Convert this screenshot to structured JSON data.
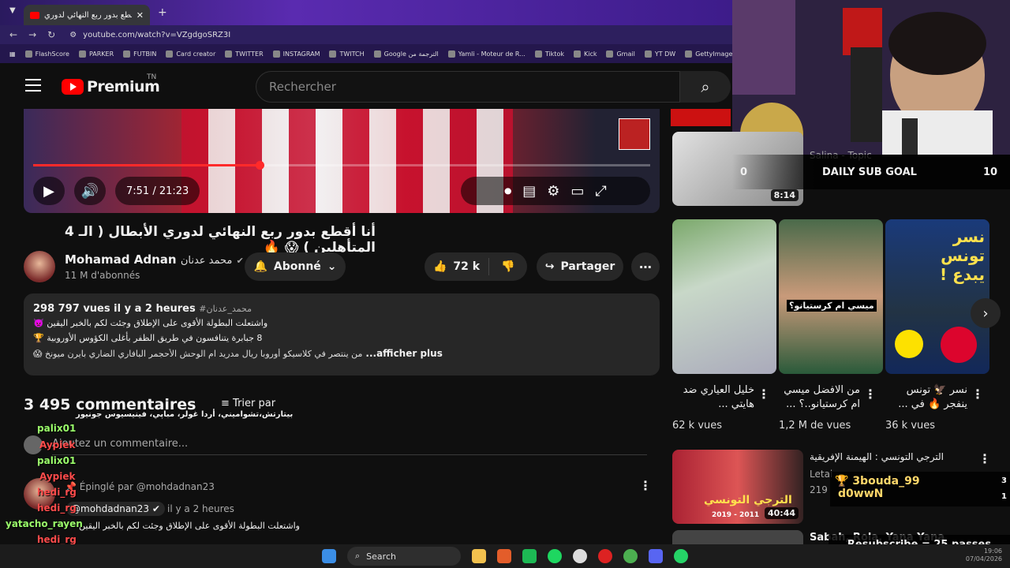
{
  "browser": {
    "tab_title": "أنا أقطع بدور ربع النهائي لدوري ...",
    "url": "youtube.com/watch?v=VZgdgoSRZ3I",
    "bookmarks": [
      "FlashScore",
      "PARKER",
      "FUTBIN",
      "Card creator",
      "TWITTER",
      "INSTAGRAM",
      "TWITCH",
      "Google الترجمة من",
      "Yamli - Moteur de R...",
      "Tiktok",
      "Kick",
      "Gmail",
      "YT DW",
      "GettyImages"
    ]
  },
  "header": {
    "logo_text": "Premium",
    "logo_sup": "TN",
    "search_placeholder": "Rechercher"
  },
  "player": {
    "time": "7:51 / 21:23",
    "progress": 0.367
  },
  "video": {
    "title": "أنا أقطع بدور ربع النهائي لدوري الأبطال ( الـ 4 المتأهلين ) 😱 🔥",
    "channel_name": "Mohamad Adnan",
    "channel_name_ar": "محمد عدنان",
    "subscribers": "11 M d'abonnés",
    "subscribe_label": "Abonné",
    "likes": "72 k",
    "share_label": "Partager"
  },
  "description": {
    "views": "298 797 vues",
    "age": "il y a 2 heures",
    "hashtag": "#محمد_عدنان",
    "lines": [
      "واشتعلت البطولة الأقوى على الإطلاق وجئت لكم بالخبر اليقين 👿",
      "8 جبابرة يتنافسون في طريق الظفر بأغلى الكؤوس الأوروبية 🏆",
      "من ينتصر في كلاسيكو أوروبا ريال مدريد ام الوحش الأحجمر البافاري الضاري بايرن ميونخ 😱"
    ],
    "more_label": "...afficher plus"
  },
  "comments": {
    "count": "3 495 commentaires",
    "sort_label": "Trier par",
    "add_placeholder": "Ajoutez un commentaire...",
    "pinned_by": "Épinglé par @mohdadnan23",
    "pinned_author": "@mohdadnan23",
    "pinned_time": "il y a 2 heures",
    "pinned_line1": "واشتعلت البطولة الأقوى على الإطلاق وجئت لكم بالخبر اليقين",
    "overlay_line": "بيتارتش،تشواميني، أردا غولر، مباپي، فينيسيوس جونيور"
  },
  "chat": {
    "names": [
      "palix01",
      "Aypiek",
      "palix01",
      "Aypiek",
      "hedi_rg",
      "hedi_rg",
      "yatacho_rayen",
      "hedi_rg",
      "hedi_rg"
    ]
  },
  "sidebar": {
    "video1_channel": "Salina - Topic",
    "video1_duration": "8:14",
    "shorts": [
      {
        "title": "خليل العياري ضد هايتي ...",
        "views": "62 k vues"
      },
      {
        "title": "من الافضل ميسي ام كرستيانو..؟ ...",
        "views": "1,2 M de vues"
      },
      {
        "title": "نسر 🦅 تونس ينفجر 🔥 في ...",
        "views": "36 k vues"
      }
    ],
    "short_overlay_texts": [
      "ميسي ام كرستيانو؟",
      "نسر تونس يبدع !"
    ],
    "video2_title": "الترجي التونسي : الهيمنة الإفريقية",
    "video2_channel": "Letai",
    "video2_views": "219",
    "video2_duration": "40:44",
    "video2_overlay": "الترجي التونسي",
    "video2_years": "2019 - 2011",
    "video3_title": "Sabah, Rola, Yana Yana"
  },
  "stream_overlay": {
    "goal_label": "DAILY SUB GOAL",
    "goal_current": "0",
    "goal_target": "10",
    "donor1": "3bouda_99",
    "donor2": "d0wwN",
    "donor1_count": "3",
    "donor2_count": "1",
    "resub_text": "Resubscribe = 25 passes"
  },
  "taskbar": {
    "search_label": "Search",
    "time": "19:06",
    "date": "07/04/2026"
  }
}
